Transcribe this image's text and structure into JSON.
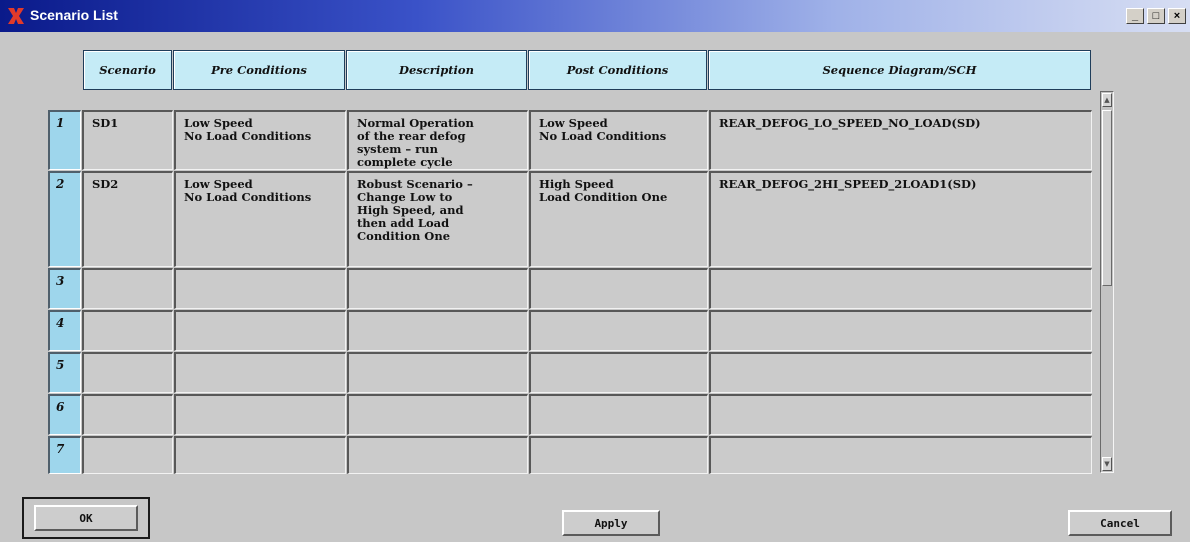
{
  "window": {
    "title": "Scenario List",
    "controls": {
      "minimize": "_",
      "maximize": "□",
      "close": "×"
    }
  },
  "table": {
    "columns": [
      "Scenario",
      "Pre Conditions",
      "Description",
      "Post Conditions",
      "Sequence Diagram/SCH"
    ],
    "rows": [
      {
        "num": "1",
        "scenario": "SD1",
        "pre": "Low Speed\nNo Load Conditions",
        "description": "Normal Operation\nof the rear defog\nsystem – run\ncomplete cycle",
        "post": "Low Speed\nNo Load Conditions",
        "sequence": "REAR_DEFOG_LO_SPEED_NO_LOAD(SD)"
      },
      {
        "num": "2",
        "scenario": "SD2",
        "pre": "Low Speed\nNo Load Conditions",
        "description": "Robust Scenario –\nChange Low to\nHigh Speed, and\nthen add Load\nCondition One",
        "post": "High Speed\nLoad Condition One",
        "sequence": "REAR_DEFOG_2HI_SPEED_2LOAD1(SD)"
      },
      {
        "num": "3",
        "scenario": "",
        "pre": "",
        "description": "",
        "post": "",
        "sequence": ""
      },
      {
        "num": "4",
        "scenario": "",
        "pre": "",
        "description": "",
        "post": "",
        "sequence": ""
      },
      {
        "num": "5",
        "scenario": "",
        "pre": "",
        "description": "",
        "post": "",
        "sequence": ""
      },
      {
        "num": "6",
        "scenario": "",
        "pre": "",
        "description": "",
        "post": "",
        "sequence": ""
      },
      {
        "num": "7",
        "scenario": "",
        "pre": "",
        "description": "",
        "post": "",
        "sequence": ""
      }
    ]
  },
  "buttons": {
    "ok": "OK",
    "apply": "Apply",
    "cancel": "Cancel"
  },
  "icons": {
    "app": "x-logo-icon",
    "scroll_up": "arrow-up-icon",
    "scroll_down": "arrow-down-icon"
  },
  "colors": {
    "header_bg": "#c5ebf6",
    "rownum_bg": "#9ed6ec",
    "cell_bg": "#cbcbcb",
    "window_bg": "#c7c7c7"
  }
}
